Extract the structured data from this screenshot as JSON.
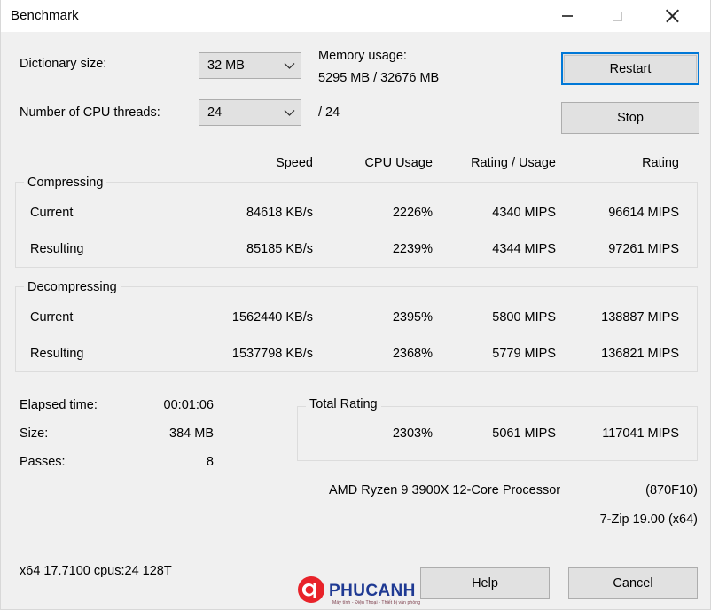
{
  "window": {
    "title": "Benchmark",
    "controls": {
      "minimize": "minimize",
      "maximize": "maximize",
      "close": "close"
    }
  },
  "settings": {
    "dictionary_label": "Dictionary size:",
    "dictionary_value": "32 MB",
    "threads_label": "Number of CPU threads:",
    "threads_value": "24",
    "threads_total": "/ 24",
    "memory_label": "Memory usage:",
    "memory_value": "5295 MB / 32676 MB"
  },
  "actions": {
    "restart": "Restart",
    "stop": "Stop",
    "help": "Help",
    "cancel": "Cancel"
  },
  "table": {
    "headers": {
      "speed": "Speed",
      "cpu_usage": "CPU Usage",
      "rating_usage": "Rating / Usage",
      "rating": "Rating"
    },
    "compressing": {
      "title": "Compressing",
      "rows": [
        {
          "label": "Current",
          "speed": "84618 KB/s",
          "cpu": "2226%",
          "rating_usage": "4340 MIPS",
          "rating": "96614 MIPS"
        },
        {
          "label": "Resulting",
          "speed": "85185 KB/s",
          "cpu": "2239%",
          "rating_usage": "4344 MIPS",
          "rating": "97261 MIPS"
        }
      ]
    },
    "decompressing": {
      "title": "Decompressing",
      "rows": [
        {
          "label": "Current",
          "speed": "1562440 KB/s",
          "cpu": "2395%",
          "rating_usage": "5800 MIPS",
          "rating": "138887 MIPS"
        },
        {
          "label": "Resulting",
          "speed": "1537798 KB/s",
          "cpu": "2368%",
          "rating_usage": "5779 MIPS",
          "rating": "136821 MIPS"
        }
      ]
    }
  },
  "stats": {
    "elapsed_label": "Elapsed time:",
    "elapsed_value": "00:01:06",
    "size_label": "Size:",
    "size_value": "384 MB",
    "passes_label": "Passes:",
    "passes_value": "8"
  },
  "total_rating": {
    "title": "Total Rating",
    "cpu": "2303%",
    "rating_usage": "5061 MIPS",
    "rating": "117041 MIPS"
  },
  "info": {
    "cpu_name": "AMD Ryzen 9 3900X 12-Core Processor",
    "cpu_id": "(870F10)",
    "version": "7-Zip 19.00 (x64)"
  },
  "statusbar": {
    "text": "x64 17.7100 cpus:24 128T"
  },
  "watermark": {
    "brand": "PHUCANH",
    "registered": "®",
    "tagline": "Máy tính - Điện Thoại - Thiết bị văn phòng",
    "red": "#e8232a",
    "navy": "#1f3a93"
  },
  "colors": {
    "focus_blue": "#0078d7",
    "body_bg": "#f0f0f0",
    "control_bg": "#e1e1e1",
    "control_border": "#adadad"
  }
}
